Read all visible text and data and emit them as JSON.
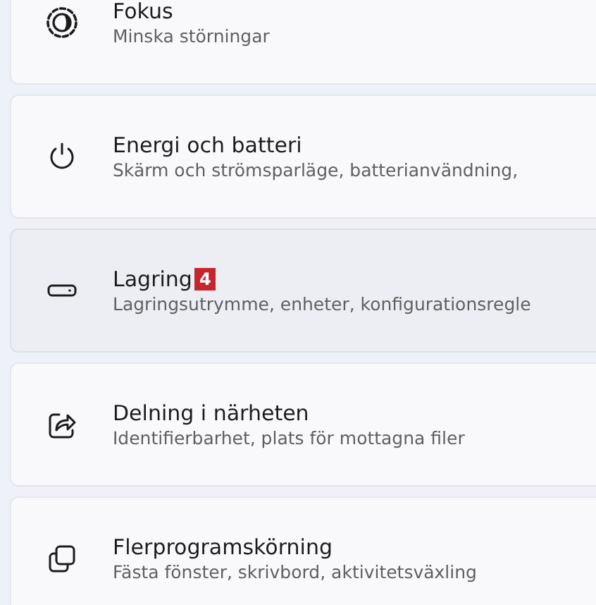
{
  "settings": [
    {
      "kind": "focus",
      "title": "Fokus",
      "subtitle": "Minska störningar",
      "selected": false
    },
    {
      "kind": "power",
      "title": "Energi och batteri",
      "subtitle": "Skärm och strömsparläge, batterianvändning,",
      "selected": false
    },
    {
      "kind": "storage",
      "title": "Lagring",
      "badge": "4",
      "subtitle": "Lagringsutrymme, enheter, konfigurationsregle",
      "selected": true
    },
    {
      "kind": "share",
      "title": "Delning i närheten",
      "subtitle": "Identifierbarhet, plats för mottagna filer",
      "selected": false
    },
    {
      "kind": "multitask",
      "title": "Flerprogramskörning",
      "subtitle": "Fästa fönster, skrivbord, aktivitetsväxling",
      "selected": false
    }
  ]
}
